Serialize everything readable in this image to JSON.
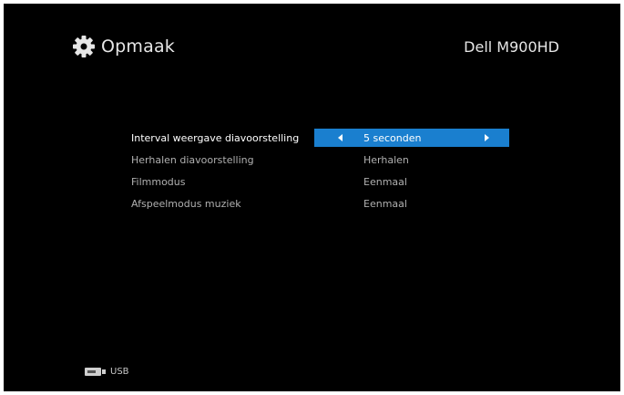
{
  "header": {
    "title": "Opmaak",
    "model": "Dell M900HD"
  },
  "menu": {
    "items": [
      {
        "label": "Interval weergave diavoorstelling",
        "value": "5 seconden",
        "selected": true
      },
      {
        "label": "Herhalen diavoorstelling",
        "value": "Herhalen",
        "selected": false
      },
      {
        "label": "Filmmodus",
        "value": "Eenmaal",
        "selected": false
      },
      {
        "label": "Afspeelmodus muziek",
        "value": "Eenmaal",
        "selected": false
      }
    ]
  },
  "footer": {
    "source_label": "USB",
    "source_icon": "usb-icon"
  },
  "colors": {
    "background": "#000000",
    "highlight": "#1a7fcf",
    "text": "#e6e6e6"
  },
  "icons": {
    "header": "gear-icon"
  }
}
